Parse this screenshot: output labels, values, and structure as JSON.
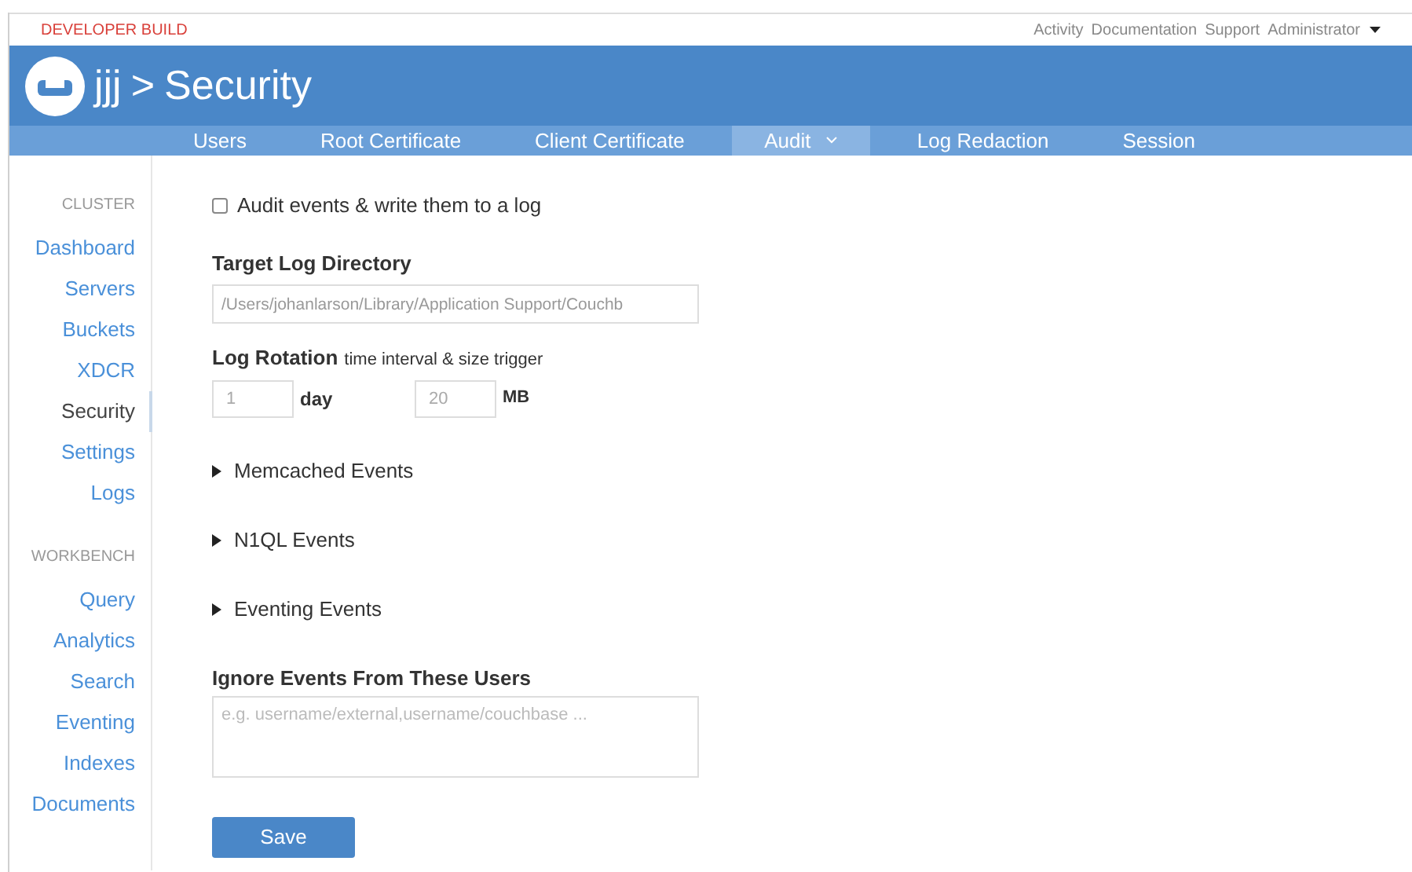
{
  "top_bar": {
    "build_label": "DEVELOPER BUILD",
    "links": [
      "Activity",
      "Documentation",
      "Support"
    ],
    "user_menu": "Administrator"
  },
  "header": {
    "bucket": "jjj",
    "separator": ">",
    "title": "Security"
  },
  "tabs": [
    {
      "label": "Users",
      "selected": false,
      "dropdown": false
    },
    {
      "label": "Root Certificate",
      "selected": false,
      "dropdown": false
    },
    {
      "label": "Client Certificate",
      "selected": false,
      "dropdown": false
    },
    {
      "label": "Audit",
      "selected": true,
      "dropdown": true
    },
    {
      "label": "Log Redaction",
      "selected": false,
      "dropdown": false
    },
    {
      "label": "Session",
      "selected": false,
      "dropdown": false
    }
  ],
  "sidebar": {
    "sections": [
      {
        "heading": "CLUSTER",
        "items": [
          {
            "label": "Dashboard",
            "selected": false
          },
          {
            "label": "Servers",
            "selected": false
          },
          {
            "label": "Buckets",
            "selected": false
          },
          {
            "label": "XDCR",
            "selected": false
          },
          {
            "label": "Security",
            "selected": true
          },
          {
            "label": "Settings",
            "selected": false
          },
          {
            "label": "Logs",
            "selected": false
          }
        ]
      },
      {
        "heading": "WORKBENCH",
        "items": [
          {
            "label": "Query",
            "selected": false
          },
          {
            "label": "Analytics",
            "selected": false
          },
          {
            "label": "Search",
            "selected": false
          },
          {
            "label": "Eventing",
            "selected": false
          },
          {
            "label": "Indexes",
            "selected": false
          },
          {
            "label": "Documents",
            "selected": false
          }
        ]
      }
    ]
  },
  "form": {
    "audit_checkbox": {
      "label": "Audit events & write them to a log",
      "checked": false
    },
    "target_dir": {
      "label": "Target Log Directory",
      "value": "/Users/johanlarson/Library/Application Support/Couchb"
    },
    "rotation": {
      "label": "Log Rotation",
      "hint": "time interval & size trigger",
      "interval": {
        "value": "1",
        "unit": "day"
      },
      "size": {
        "value": "20",
        "unit": "MB"
      }
    },
    "sections": [
      {
        "label": "Memcached Events",
        "expanded": false
      },
      {
        "label": "N1QL Events",
        "expanded": false
      },
      {
        "label": "Eventing Events",
        "expanded": false
      }
    ],
    "ignore_users": {
      "label": "Ignore Events From These Users",
      "placeholder": "e.g. username/external,username/couchbase ..."
    },
    "save_button": "Save"
  }
}
